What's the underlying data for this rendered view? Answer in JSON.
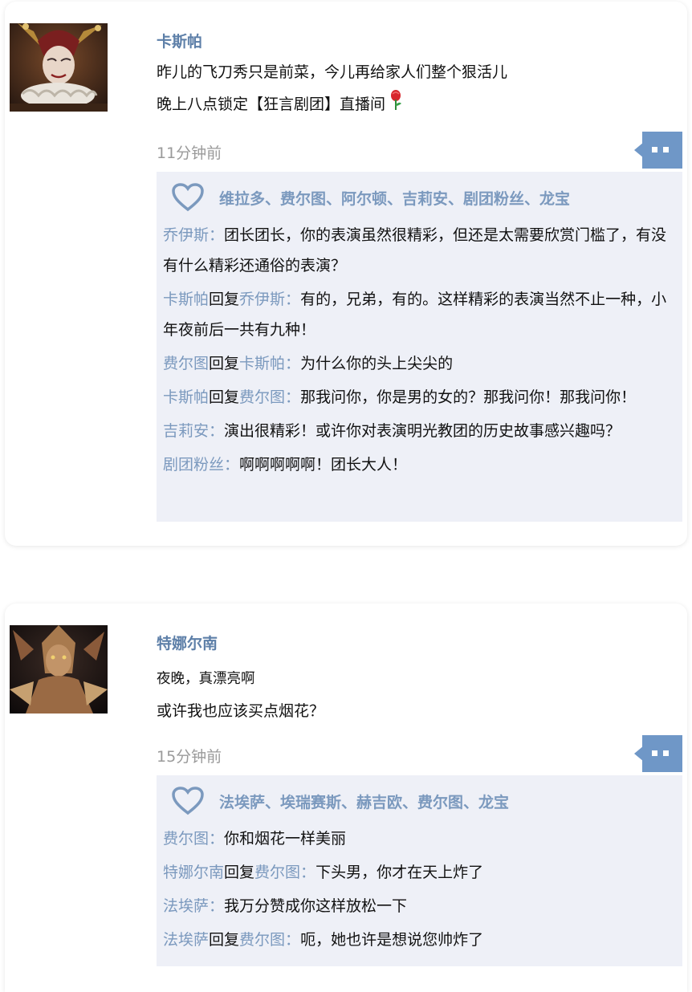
{
  "posts": [
    {
      "author": "卡斯帕",
      "avatar_icon": "jester-avatar-icon",
      "lines": [
        "昨儿的飞刀秀只是前菜，今儿再给家人们整个狠活儿",
        "晚上八点锁定【狂言剧团】直播间"
      ],
      "emoji": "rose-icon",
      "time": "11分钟前",
      "likes": "维拉多、费尔图、阿尔顿、吉莉安、剧团粉丝、龙宝",
      "comments": [
        {
          "from": "乔伊斯",
          "to": "",
          "sep": "：",
          "text": "团长团长，你的表演虽然很精彩，但还是太需要欣赏门槛了，有没有什么精彩还通俗的表演？"
        },
        {
          "from": "卡斯帕",
          "reply": "回复",
          "to": "乔伊斯",
          "sep": "：",
          "text": "有的，兄弟，有的。这样精彩的表演当然不止一种，小年夜前后一共有九种！"
        },
        {
          "from": "费尔图",
          "reply": "回复",
          "to": "卡斯帕",
          "sep": "：",
          "text": "为什么你的头上尖尖的"
        },
        {
          "from": "卡斯帕",
          "reply": "回复",
          "to": "费尔图",
          "sep": "：",
          "text": "那我问你，你是男的女的？那我问你！那我问你！"
        },
        {
          "from": "吉莉安",
          "to": "",
          "sep": "：",
          "text": "演出很精彩！或许你对表演明光教团的历史故事感兴趣吗？"
        },
        {
          "from": "剧团粉丝",
          "to": "",
          "sep": "：",
          "text": "啊啊啊啊啊！团长大人！"
        }
      ]
    },
    {
      "author": "特娜尔南",
      "avatar_icon": "winged-creature-avatar-icon",
      "lines": [
        "夜晚，真漂亮啊",
        "或许我也应该买点烟花？"
      ],
      "time": "15分钟前",
      "likes": "法埃萨、埃瑞赛斯、赫吉欧、费尔图、龙宝",
      "comments": [
        {
          "from": "费尔图",
          "to": "",
          "sep": "：",
          "text": "你和烟花一样美丽"
        },
        {
          "from": "特娜尔南",
          "reply": "回复",
          "to": "费尔图",
          "sep": "：",
          "text": "下头男，你才在天上炸了"
        },
        {
          "from": "法埃萨",
          "to": "",
          "sep": "：",
          "text": "我万分赞成你这样放松一下"
        },
        {
          "from": "法埃萨",
          "reply": "回复",
          "to": "费尔图",
          "sep": "：",
          "text": "呃，她也许是想说您帅炸了"
        }
      ]
    }
  ],
  "colors": {
    "name": "#5d7fa8",
    "link": "#7b99be",
    "panel": "#eef0f7",
    "time": "#9a9a9a",
    "comment_button": "#6f97c7"
  }
}
